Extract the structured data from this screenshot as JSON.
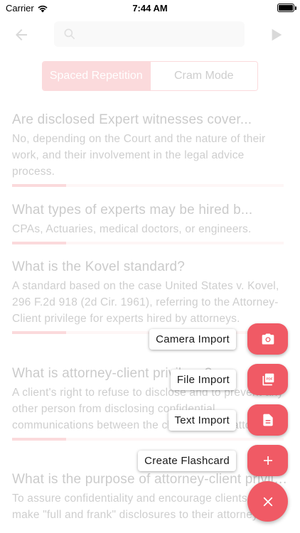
{
  "status_bar": {
    "carrier": "Carrier",
    "time": "7:44 AM"
  },
  "mode_toggle": {
    "spaced_repetition": "Spaced Repetition",
    "cram_mode": "Cram Mode",
    "active": "spaced_repetition"
  },
  "cards": [
    {
      "question": "Are disclosed Expert witnesses cover...",
      "answer": "No, depending on the Court and the nature of their work, and their involvement in the legal advice process.",
      "progress": 0.2
    },
    {
      "question": "What types of experts may be hired b...",
      "answer": "CPAs, Actuaries, medical doctors, or engineers.",
      "progress": 0.2
    },
    {
      "question": "What is the Kovel standard?",
      "answer": "A standard based on the case United States v. Kovel, 296 F.2d 918 (2d Cir. 1961), referring to the Attorney-Client privilege for experts hired by attorneys.",
      "progress": 0.2
    },
    {
      "question": "What is attorney-client privilege?",
      "answer": "A client's right to refuse to disclose and to prevent any other person from disclosing confidential communications between the client and the attorney.",
      "progress": 0.2
    },
    {
      "question": "What is the purpose of attorney-client privilege?",
      "answer": "To assure confidentiality and encourage clients to make \"full and frank\" disclosures to their attorneys.",
      "progress": 0.2
    }
  ],
  "fab_menu": {
    "camera_import": "Camera Import",
    "file_import": "File Import",
    "text_import": "Text Import",
    "create_flashcard": "Create Flashcard"
  },
  "colors": {
    "accent": "#f05a65",
    "progress_track": "#fbd7da"
  },
  "icons": {
    "camera": "camera-icon",
    "file": "pdf-file-icon",
    "text": "document-icon",
    "create": "plus-icon",
    "close": "close-icon"
  }
}
